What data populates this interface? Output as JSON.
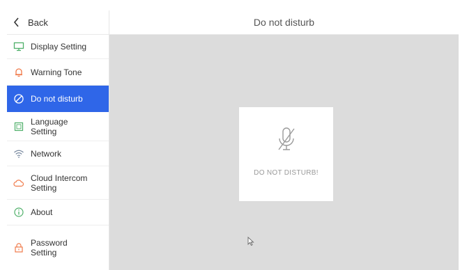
{
  "header": {
    "back_label": "Back",
    "title": "Do not disturb"
  },
  "sidebar": {
    "items": [
      {
        "label": "Display Setting",
        "icon": "monitor-icon",
        "active": false
      },
      {
        "label": "Warning Tone",
        "icon": "bell-icon",
        "active": false
      },
      {
        "label": "Do not disturb",
        "icon": "do-not-disturb-icon",
        "active": true
      },
      {
        "label": "Language Setting",
        "icon": "language-icon",
        "active": false
      },
      {
        "label": "Network",
        "icon": "wifi-icon",
        "active": false
      },
      {
        "label": "Cloud Intercom Setting",
        "icon": "cloud-icon",
        "active": false
      },
      {
        "label": "About",
        "icon": "info-icon",
        "active": false
      },
      {
        "label": "Password Setting",
        "icon": "lock-icon",
        "active": false
      }
    ]
  },
  "main": {
    "card_text": "DO NOT DISTURB!",
    "card_icon": "mic-off-icon"
  },
  "colors": {
    "accent": "#2f66e8",
    "icon_green": "#4fb06a",
    "icon_orange": "#f07a4a",
    "content_bg": "#dcdcdc"
  }
}
